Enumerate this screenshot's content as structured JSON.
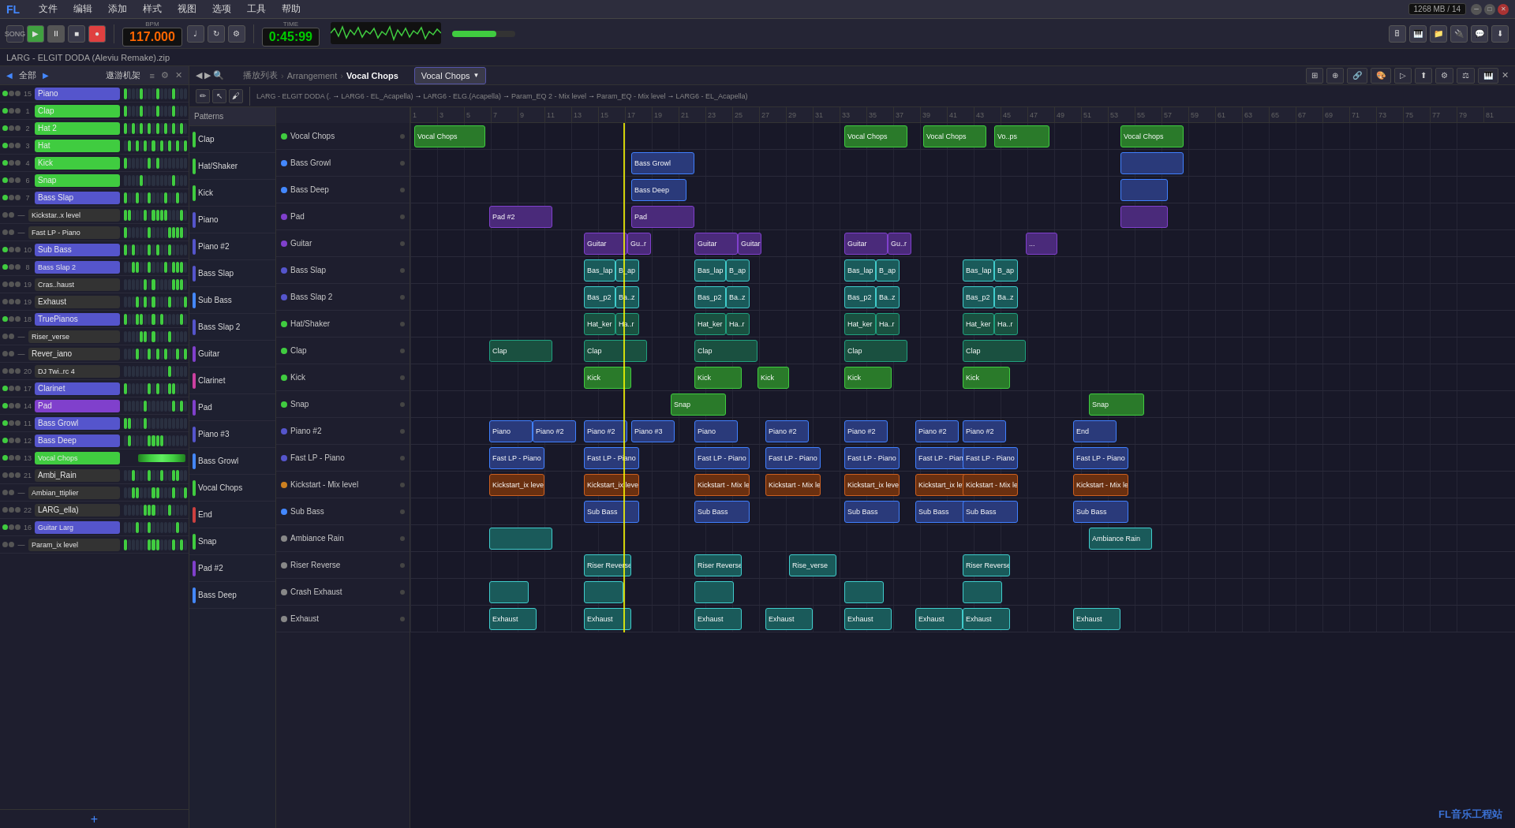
{
  "app": {
    "title": "FL Studio",
    "file": "LARG - ELGIT DODA (Aleviu Remake).zip"
  },
  "menu": {
    "items": [
      "文件",
      "编辑",
      "添加",
      "样式",
      "视图",
      "选项",
      "工具",
      "帮助"
    ]
  },
  "transport": {
    "bpm": "117.000",
    "time": "0:45",
    "beats": "99",
    "play_label": "▶",
    "stop_label": "■",
    "record_label": "●",
    "pattern_label": "SONG"
  },
  "title_bar": {
    "file": "LARG - ELGIT DODA (Aleviu Remake).zip"
  },
  "left_panel": {
    "title": "全部",
    "subtitle": "遨游机架",
    "channels": [
      {
        "num": "15",
        "name": "Piano",
        "color": "#5555cc"
      },
      {
        "num": "1",
        "name": "Clap",
        "color": "#40cc40"
      },
      {
        "num": "2",
        "name": "Hat 2",
        "color": "#40cc40"
      },
      {
        "num": "3",
        "name": "Hat",
        "color": "#40cc40"
      },
      {
        "num": "4",
        "name": "Kick",
        "color": "#40cc40"
      },
      {
        "num": "6",
        "name": "Snap",
        "color": "#40cc40"
      },
      {
        "num": "7",
        "name": "Bass Slap",
        "color": "#5555cc"
      },
      {
        "num": "—",
        "name": "Kickstar..x level",
        "color": "#555"
      },
      {
        "num": "—",
        "name": "Fast LP - Piano",
        "color": "#555"
      },
      {
        "num": "10",
        "name": "Sub Bass",
        "color": "#5555cc"
      },
      {
        "num": "8",
        "name": "Bass Slap 2",
        "color": "#5555cc"
      },
      {
        "num": "19",
        "name": "Cras..haust",
        "color": "#555"
      },
      {
        "num": "19",
        "name": "Exhaust",
        "color": "#555"
      },
      {
        "num": "18",
        "name": "TruePianos",
        "color": "#5555cc"
      },
      {
        "num": "—",
        "name": "Riser_verse",
        "color": "#555"
      },
      {
        "num": "—",
        "name": "Rever_iano",
        "color": "#555"
      },
      {
        "num": "20",
        "name": "DJ Twi..rc 4",
        "color": "#555"
      },
      {
        "num": "17",
        "name": "Clarinet",
        "color": "#5555cc"
      },
      {
        "num": "14",
        "name": "Pad",
        "color": "#8040cc"
      },
      {
        "num": "11",
        "name": "Bass Growl",
        "color": "#5555cc"
      },
      {
        "num": "12",
        "name": "Bass Deep",
        "color": "#5555cc"
      },
      {
        "num": "13",
        "name": "Vocal Chops",
        "color": "#40cc40"
      },
      {
        "num": "21",
        "name": "Ambi_Rain",
        "color": "#555"
      },
      {
        "num": "—",
        "name": "Ambian_ttiplier",
        "color": "#555"
      },
      {
        "num": "22",
        "name": "LARG_ella)",
        "color": "#555"
      },
      {
        "num": "16",
        "name": "Guitar Larg",
        "color": "#5555cc"
      },
      {
        "num": "—",
        "name": "Param_ix level",
        "color": "#555"
      }
    ]
  },
  "pattern_panel": {
    "title": "播放列表",
    "patterns": [
      {
        "name": "Clap",
        "color": "#40cc40"
      },
      {
        "name": "Hat/Shaker",
        "color": "#40cc40"
      },
      {
        "name": "Kick",
        "color": "#40cc40"
      },
      {
        "name": "Piano",
        "color": "#5555cc"
      },
      {
        "name": "Piano #2",
        "color": "#5555cc"
      },
      {
        "name": "Bass Slap",
        "color": "#5555cc"
      },
      {
        "name": "Sub Bass",
        "color": "#4488ff"
      },
      {
        "name": "Bass Slap 2",
        "color": "#5555cc"
      },
      {
        "name": "Guitar",
        "color": "#8040cc"
      },
      {
        "name": "Clarinet",
        "color": "#cc40a0"
      },
      {
        "name": "Pad",
        "color": "#8040cc"
      },
      {
        "name": "Piano #3",
        "color": "#5555cc"
      },
      {
        "name": "Bass Growl",
        "color": "#4488ff"
      },
      {
        "name": "Vocal Chops",
        "color": "#40cc40"
      },
      {
        "name": "End",
        "color": "#cc4040"
      },
      {
        "name": "Snap",
        "color": "#40cc40"
      },
      {
        "name": "Pad #2",
        "color": "#8040cc"
      },
      {
        "name": "Bass Deep",
        "color": "#4488ff"
      }
    ]
  },
  "arrangement": {
    "title": "播放列表 - Arrangement",
    "breadcrumb": [
      "播放列表",
      "Arrangement",
      "Vocal Chops"
    ],
    "active_pattern": "Vocal Chops",
    "tracks": [
      {
        "name": "Vocal Chops",
        "color": "#40cc40"
      },
      {
        "name": "Bass Growl",
        "color": "#4488ff"
      },
      {
        "name": "Bass Deep",
        "color": "#4488ff"
      },
      {
        "name": "Pad",
        "color": "#8040cc"
      },
      {
        "name": "Guitar",
        "color": "#8040cc"
      },
      {
        "name": "Bass Slap",
        "color": "#5555cc"
      },
      {
        "name": "Bass Slap 2",
        "color": "#5555cc"
      },
      {
        "name": "Hat/Shaker",
        "color": "#40cc40"
      },
      {
        "name": "Clap",
        "color": "#40cc40"
      },
      {
        "name": "Kick",
        "color": "#40cc40"
      },
      {
        "name": "Snap",
        "color": "#40cc40"
      },
      {
        "name": "Piano #2",
        "color": "#5555cc"
      },
      {
        "name": "Fast LP - Piano",
        "color": "#5555cc"
      },
      {
        "name": "Kickstart - Mix level",
        "color": "#cc8020"
      },
      {
        "name": "Sub Bass",
        "color": "#4488ff"
      },
      {
        "name": "Ambiance Rain",
        "color": "#888"
      },
      {
        "name": "Riser Reverse",
        "color": "#888"
      },
      {
        "name": "Crash Exhaust",
        "color": "#888"
      },
      {
        "name": "Exhaust",
        "color": "#888"
      }
    ]
  },
  "ruler": {
    "marks": [
      "1",
      "3",
      "5",
      "7",
      "9",
      "11",
      "13",
      "15",
      "17",
      "19",
      "21",
      "23",
      "25",
      "27",
      "29",
      "31",
      "33",
      "35",
      "37",
      "39",
      "41",
      "43",
      "45",
      "47",
      "49",
      "51",
      "53",
      "55",
      "57",
      "59",
      "61",
      "63",
      "65",
      "67",
      "69",
      "71",
      "73",
      "75",
      "77",
      "79",
      "81"
    ]
  },
  "watermark": "FL音乐工程站"
}
